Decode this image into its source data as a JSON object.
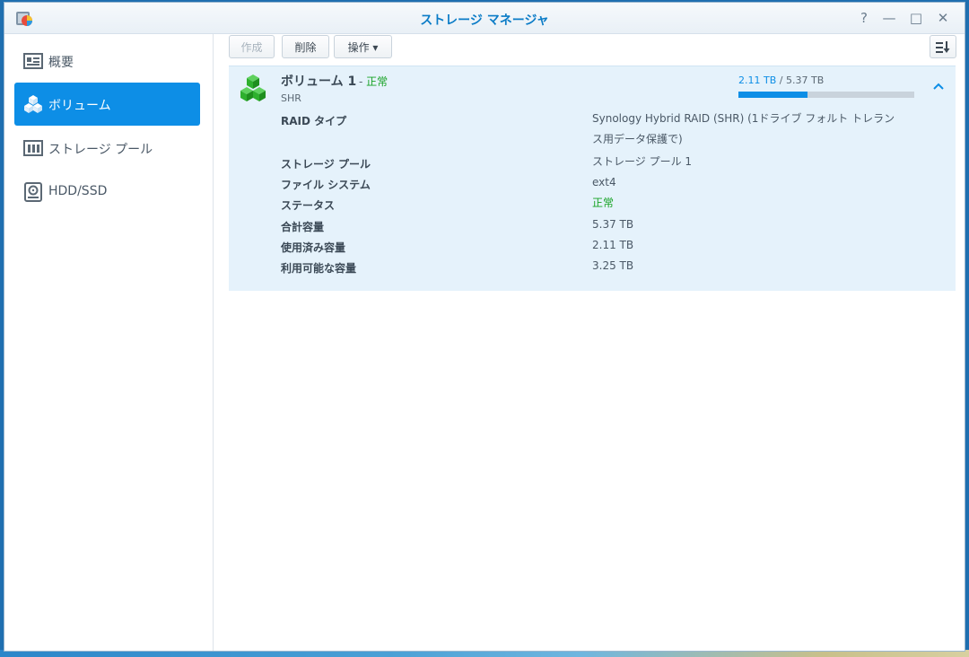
{
  "window": {
    "title": "ストレージ マネージャ",
    "buttons": {
      "help": "?",
      "minimize": "—",
      "maximize": "□",
      "close": "✕"
    }
  },
  "sidebar": {
    "items": [
      {
        "label": "概要",
        "icon": "overview-icon",
        "active": false
      },
      {
        "label": "ボリューム",
        "icon": "volume-icon",
        "active": true
      },
      {
        "label": "ストレージ プール",
        "icon": "storage-pool-icon",
        "active": false
      },
      {
        "label": "HDD/SSD",
        "icon": "hdd-icon",
        "active": false
      }
    ]
  },
  "toolbar": {
    "create_label": "作成",
    "delete_label": "削除",
    "action_label": "操作 ▾",
    "sort_icon": "sort-icon"
  },
  "volume": {
    "title": "ボリューム 1",
    "status_prefix": "-",
    "status": "正常",
    "type": "SHR",
    "used_text": "2.11 TB",
    "separator": "/",
    "total_text": "5.37 TB",
    "usage_fraction": 0.393,
    "properties": [
      {
        "key": "RAID タイプ",
        "value": "Synology Hybrid RAID (SHR) (1ドライブ フォルト トレラン ス用データ保護で)"
      },
      {
        "key": "ストレージ プール",
        "value": "ストレージ プール 1"
      },
      {
        "key": "ファイル システム",
        "value": "ext4"
      },
      {
        "key": "ステータス",
        "value": "正常",
        "status": "ok"
      },
      {
        "key": "合計容量",
        "value": "5.37 TB"
      },
      {
        "key": "使用済み容量",
        "value": "2.11 TB"
      },
      {
        "key": "利用可能な容量",
        "value": "3.25 TB"
      }
    ]
  },
  "colors": {
    "accent": "#0d8ee6",
    "status_ok": "#17a325",
    "card_bg": "#e5f2fb",
    "title": "#0b7cc7"
  }
}
